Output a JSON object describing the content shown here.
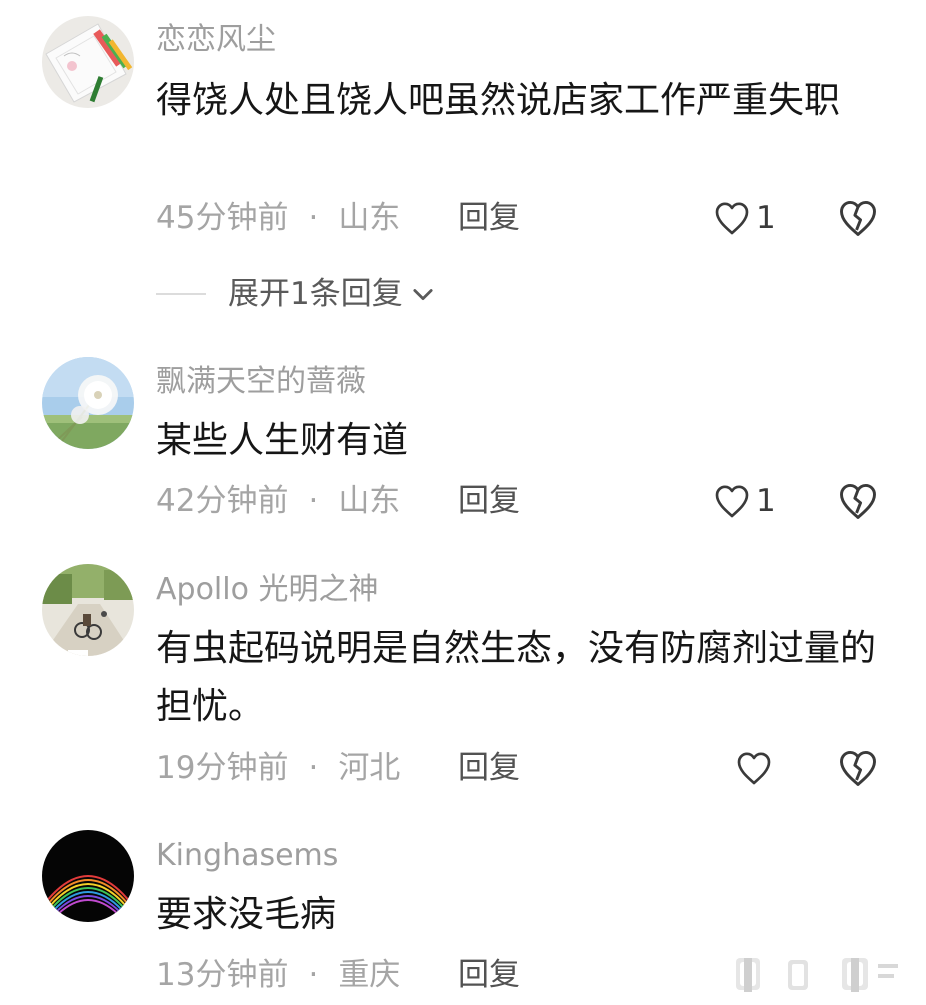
{
  "comments": [
    {
      "username": "恋恋风尘",
      "content": "得饶人处且饶人吧虽然说店家工作严重失职",
      "time": "45分钟前",
      "separator": "·",
      "location": "山东",
      "reply_label": "回复",
      "likes": "1",
      "expand_label": "展开1条回复"
    },
    {
      "username": "飘满天空的蔷薇",
      "content": "某些人生财有道",
      "time": "42分钟前",
      "separator": "·",
      "location": "山东",
      "reply_label": "回复",
      "likes": "1"
    },
    {
      "username": "Apollo 光明之神",
      "content": "有虫起码说明是自然生态，没有防腐剂过量的担忧。",
      "time": "19分钟前",
      "separator": "·",
      "location": "河北",
      "reply_label": "回复",
      "likes": ""
    },
    {
      "username": "Kinghasems",
      "content": "要求没毛病",
      "time": "13分钟前",
      "separator": "·",
      "location": "重庆",
      "reply_label": "回复",
      "likes": ""
    }
  ],
  "icons": {
    "like": "heart-outline-icon",
    "dislike": "broken-heart-icon",
    "expand": "chevron-down-icon"
  },
  "colors": {
    "text_primary": "#161616",
    "text_secondary": "#9e9e9e",
    "icon": "#3a3a3a"
  }
}
